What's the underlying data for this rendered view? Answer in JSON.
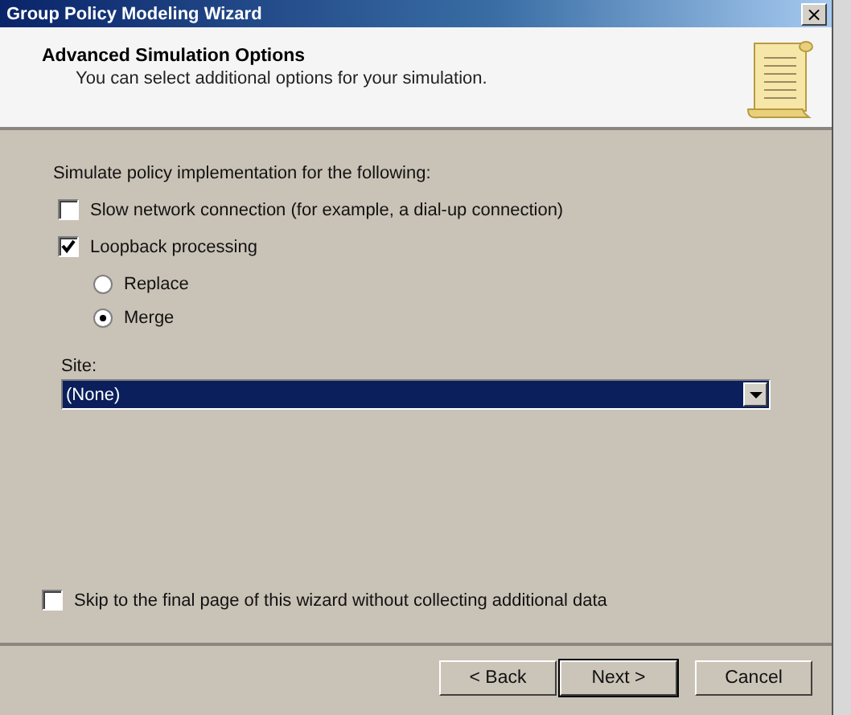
{
  "window": {
    "title": "Group Policy Modeling Wizard",
    "close": "×"
  },
  "header": {
    "title": "Advanced Simulation Options",
    "subtitle": "You can select additional options for your simulation."
  },
  "section_label": "Simulate policy implementation for the following:",
  "options": [
    {
      "kind": "checkbox",
      "label": "Slow network connection (for example, a dial-up connection)",
      "checked": false
    },
    {
      "kind": "checkbox",
      "label": "Loopback processing",
      "checked": true
    },
    {
      "kind": "radio",
      "label": "Replace",
      "selected": false
    },
    {
      "kind": "radio",
      "label": "Merge",
      "selected": true
    }
  ],
  "site": {
    "label": "Site:",
    "value": "(None)"
  },
  "skip": {
    "label": "Skip to the final page of this wizard without collecting additional data",
    "checked": false
  },
  "buttons": [
    {
      "label": "< Back",
      "default": false
    },
    {
      "label": "Next >",
      "default": true
    },
    {
      "label": "Cancel",
      "default": false
    }
  ]
}
